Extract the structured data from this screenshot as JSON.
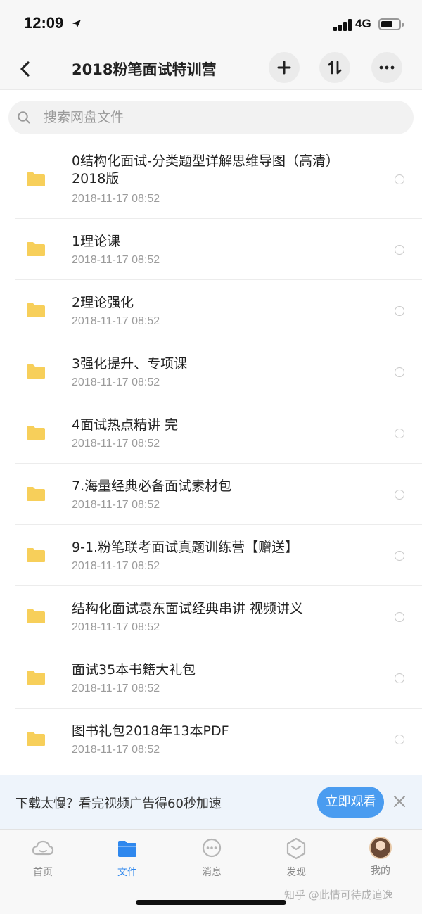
{
  "status_bar": {
    "time": "12:09",
    "network": "4G"
  },
  "nav": {
    "title": "2018粉笔面试特训营"
  },
  "search": {
    "placeholder": "搜索网盘文件"
  },
  "files": [
    {
      "name": "0结构化面试-分类题型详解思维导图（高清）2018版",
      "date": "2018-11-17 08:52"
    },
    {
      "name": "1理论课",
      "date": "2018-11-17 08:52"
    },
    {
      "name": "2理论强化",
      "date": "2018-11-17 08:52"
    },
    {
      "name": "3强化提升、专项课",
      "date": "2018-11-17 08:52"
    },
    {
      "name": "4面试热点精讲 完",
      "date": "2018-11-17 08:52"
    },
    {
      "name": "7.海量经典必备面试素材包",
      "date": "2018-11-17 08:52"
    },
    {
      "name": "9-1.粉笔联考面试真题训练营【赠送】",
      "date": "2018-11-17 08:52"
    },
    {
      "name": "结构化面试袁东面试经典串讲 视频讲义",
      "date": "2018-11-17 08:52"
    },
    {
      "name": "面试35本书籍大礼包",
      "date": "2018-11-17 08:52"
    },
    {
      "name": "图书礼包2018年13本PDF",
      "date": "2018-11-17 08:52"
    }
  ],
  "banner": {
    "text": "下载太慢？看完视频广告得60秒加速",
    "button": "立即观看"
  },
  "tabs": [
    {
      "label": "首页",
      "icon": "cloud-icon"
    },
    {
      "label": "文件",
      "icon": "folder-icon"
    },
    {
      "label": "消息",
      "icon": "chat-icon"
    },
    {
      "label": "发现",
      "icon": "compass-icon"
    },
    {
      "label": "我的",
      "icon": "avatar"
    }
  ],
  "watermark": "知乎 @此情可待成追逸",
  "colors": {
    "accent": "#2f88ee",
    "folder": "#f7cf5a",
    "banner_bg": "#eef4fb",
    "button": "#4a9cf0"
  }
}
